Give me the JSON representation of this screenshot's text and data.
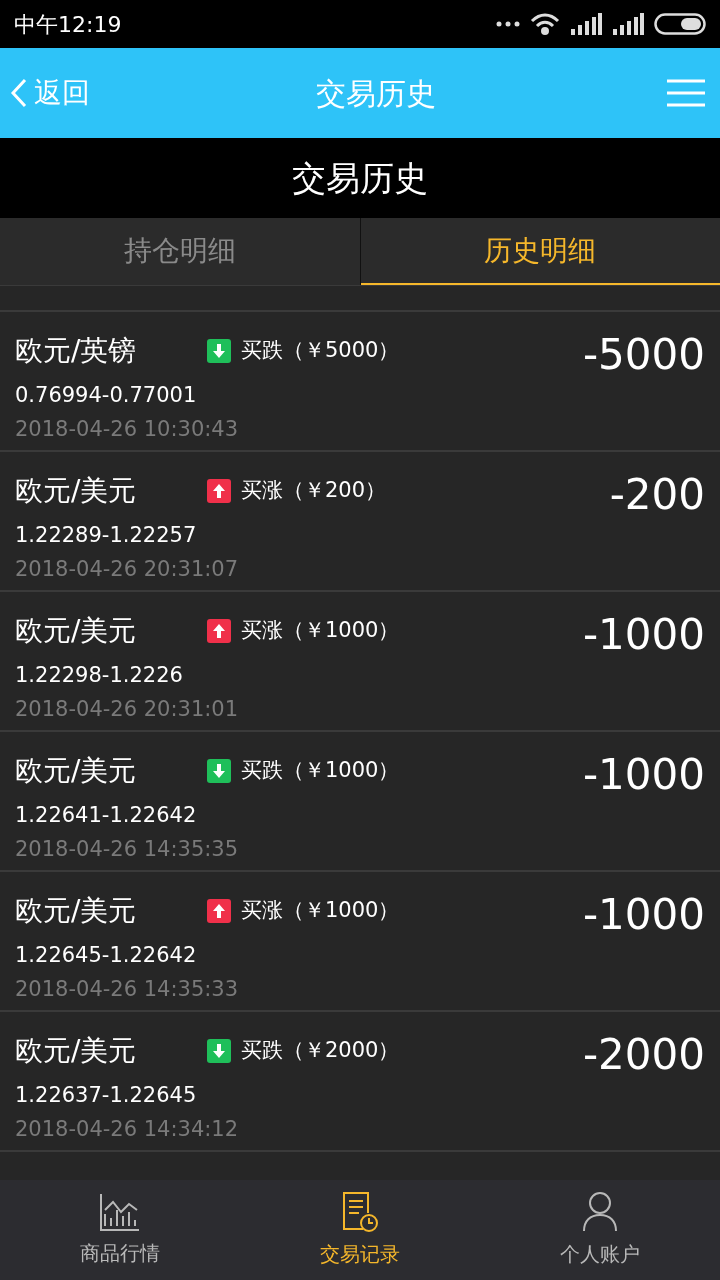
{
  "status_bar": {
    "time": "中午12:19"
  },
  "header": {
    "back": "返回",
    "title": "交易历史"
  },
  "page_title": "交易历史",
  "tabs": [
    {
      "label": "持仓明细",
      "selected": false
    },
    {
      "label": "历史明细",
      "selected": true
    }
  ],
  "trades": [
    {
      "pair": "欧元/英镑",
      "kind": "down",
      "action": "买跌（￥5000）",
      "prices": "0.76994-0.77001",
      "time": "2018-04-26 10:30:43",
      "amount": "-5000"
    },
    {
      "pair": "欧元/美元",
      "kind": "up",
      "action": "买涨（￥200）",
      "prices": "1.22289-1.22257",
      "time": "2018-04-26 20:31:07",
      "amount": "-200"
    },
    {
      "pair": "欧元/美元",
      "kind": "up",
      "action": "买涨（￥1000）",
      "prices": "1.22298-1.2226",
      "time": "2018-04-26 20:31:01",
      "amount": "-1000"
    },
    {
      "pair": "欧元/美元",
      "kind": "down",
      "action": "买跌（￥1000）",
      "prices": "1.22641-1.22642",
      "time": "2018-04-26 14:35:35",
      "amount": "-1000"
    },
    {
      "pair": "欧元/美元",
      "kind": "up",
      "action": "买涨（￥1000）",
      "prices": "1.22645-1.22642",
      "time": "2018-04-26 14:35:33",
      "amount": "-1000"
    },
    {
      "pair": "欧元/美元",
      "kind": "down",
      "action": "买跌（￥2000）",
      "prices": "1.22637-1.22645",
      "time": "2018-04-26 14:34:12",
      "amount": "-2000"
    }
  ],
  "bottom_nav": [
    {
      "label": "商品行情",
      "kind": "chart",
      "selected": false
    },
    {
      "label": "交易记录",
      "kind": "record",
      "selected": true
    },
    {
      "label": "个人账户",
      "kind": "person",
      "selected": false
    }
  ]
}
